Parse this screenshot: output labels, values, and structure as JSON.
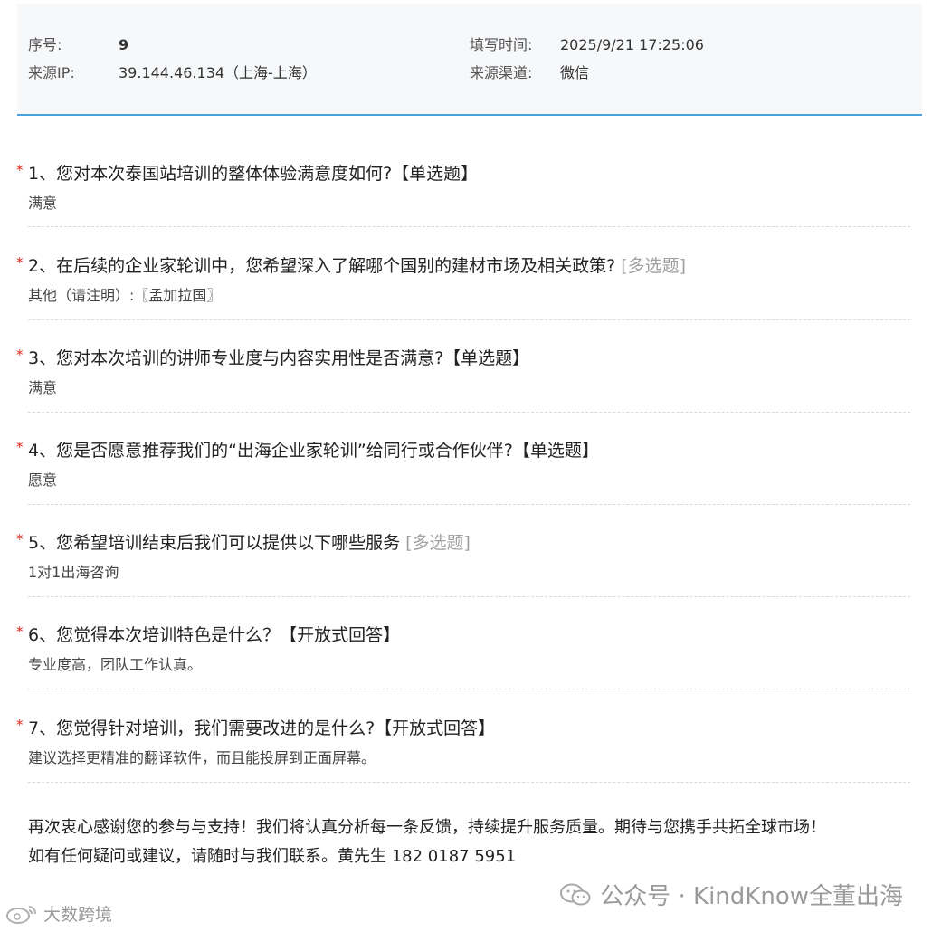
{
  "meta": {
    "seq_label": "序号:",
    "seq_value": "9",
    "ip_label": "来源IP:",
    "ip_value": "39.144.46.134（上海-上海）",
    "time_label": "填写时间:",
    "time_value": "2025/9/21 17:25:06",
    "channel_label": "来源渠道:",
    "channel_value": "微信"
  },
  "questions": [
    {
      "star": "*",
      "title": "1、您对本次泰国站培训的整体体验满意度如何?【单选题】",
      "type": "",
      "answer": "满意"
    },
    {
      "star": "*",
      "title": "2、在后续的企业家轮训中，您希望深入了解哪个国别的建材市场及相关政策? ",
      "type": "[多选题]",
      "answer": "其他（请注明）:〖孟加拉国〗"
    },
    {
      "star": "*",
      "title": "3、您对本次培训的讲师专业度与内容实用性是否满意?【单选题】",
      "type": "",
      "answer": "满意"
    },
    {
      "star": "*",
      "title": "4、您是否愿意推荐我们的“出海企业家轮训”给同行或合作伙伴?【单选题】",
      "type": "",
      "answer": "愿意"
    },
    {
      "star": "*",
      "title": "5、您希望培训结束后我们可以提供以下哪些服务 ",
      "type": "[多选题]",
      "answer": "1对1出海咨询"
    },
    {
      "star": "*",
      "title": "6、您觉得本次培训特色是什么？【开放式回答】",
      "type": "",
      "answer": "专业度高，团队工作认真。"
    },
    {
      "star": "*",
      "title": "7、您觉得针对培训，我们需要改进的是什么?【开放式回答】",
      "type": "",
      "answer": "建议选择更精准的翻译软件，而且能投屏到正面屏幕。"
    }
  ],
  "closing": {
    "line1": "再次衷心感谢您的参与与支持！我们将认真分析每一条反馈，持续提升服务质量。期待与您携手共拓全球市场！",
    "line2": "如有任何疑问或建议，请随时与我们联系。黄先生 182 0187 5951"
  },
  "watermark": {
    "text": "公众号 · KindKnow全董出海",
    "icon": "wechat-icon"
  },
  "watermark2": {
    "text": "大数跨境",
    "icon": "weibo-icon"
  },
  "colors": {
    "accent_border": "#4aa3df",
    "required_star": "#e0261a",
    "meta_bg": "#f7f8fa"
  }
}
